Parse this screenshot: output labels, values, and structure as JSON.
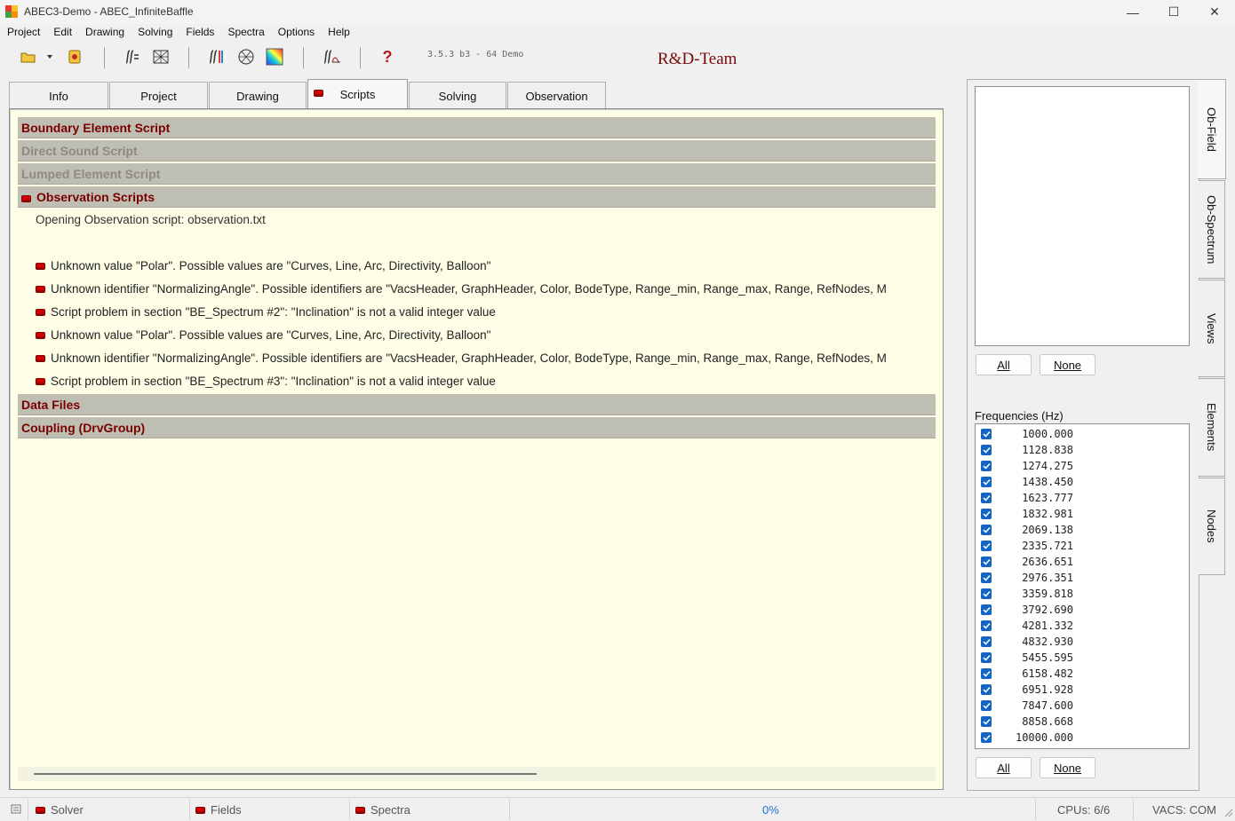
{
  "window": {
    "title": "ABEC3-Demo - ABEC_InfiniteBaffle",
    "minimize": "—",
    "maximize": "☐",
    "close": "✕"
  },
  "menu": [
    "Project",
    "Edit",
    "Drawing",
    "Solving",
    "Fields",
    "Spectra",
    "Options",
    "Help"
  ],
  "toolbar": {
    "version": "3.5.3 b3 - 64 Demo",
    "brand": "R&D-Team",
    "help_glyph": "?"
  },
  "tabs": [
    {
      "label": "Info"
    },
    {
      "label": "Project"
    },
    {
      "label": "Drawing"
    },
    {
      "label": "Scripts"
    },
    {
      "label": "Solving"
    },
    {
      "label": "Observation"
    }
  ],
  "scripts": {
    "sections_top": [
      {
        "title": "Boundary Element Script",
        "dim": false
      },
      {
        "title": "Direct Sound Script",
        "dim": true
      },
      {
        "title": "Lumped Element Script",
        "dim": true
      },
      {
        "title": "Observation Scripts",
        "dim": false
      }
    ],
    "opening_line": "Opening Observation script: observation.txt",
    "messages": [
      "Unknown value \"Polar\". Possible values are \"Curves, Line, Arc, Directivity, Balloon\"",
      "Unknown identifier \"NormalizingAngle\". Possible identifiers are \"VacsHeader, GraphHeader, Color, BodeType, Range_min, Range_max, Range, RefNodes, M",
      "Script problem in section \"BE_Spectrum #2\":  \"Inclination\" is not a valid integer value",
      "Unknown value \"Polar\". Possible values are \"Curves, Line, Arc, Directivity, Balloon\"",
      "Unknown identifier \"NormalizingAngle\". Possible identifiers are \"VacsHeader, GraphHeader, Color, BodeType, Range_min, Range_max, Range, RefNodes, M",
      "Script problem in section \"BE_Spectrum #3\":  \"Inclination\" is not a valid integer value"
    ],
    "sections_bottom": [
      {
        "title": "Data Files"
      },
      {
        "title": "Coupling (DrvGroup)"
      }
    ]
  },
  "right_panel": {
    "all_label": "All",
    "none_label": "None",
    "frequencies_label": "Frequencies  (Hz)",
    "frequencies": [
      "1000.000",
      "1128.838",
      "1274.275",
      "1438.450",
      "1623.777",
      "1832.981",
      "2069.138",
      "2335.721",
      "2636.651",
      "2976.351",
      "3359.818",
      "3792.690",
      "4281.332",
      "4832.930",
      "5455.595",
      "6158.482",
      "6951.928",
      "7847.600",
      "8858.668",
      "10000.000"
    ],
    "side_tabs": [
      "Ob-Field",
      "Ob-Spectrum",
      "Views",
      "Elements",
      "Nodes"
    ]
  },
  "status": {
    "solver": "Solver",
    "fields": "Fields",
    "spectra": "Spectra",
    "progress": "0%",
    "cpus": "CPUs: 6/6",
    "vacs": "VACS: COM"
  },
  "colors": {
    "section_text": "#7a0000",
    "panel_bg": "#fefee6",
    "section_bg": "#bfbeb3",
    "check_blue": "#1565c0",
    "progress_blue": "#1a73c9"
  }
}
